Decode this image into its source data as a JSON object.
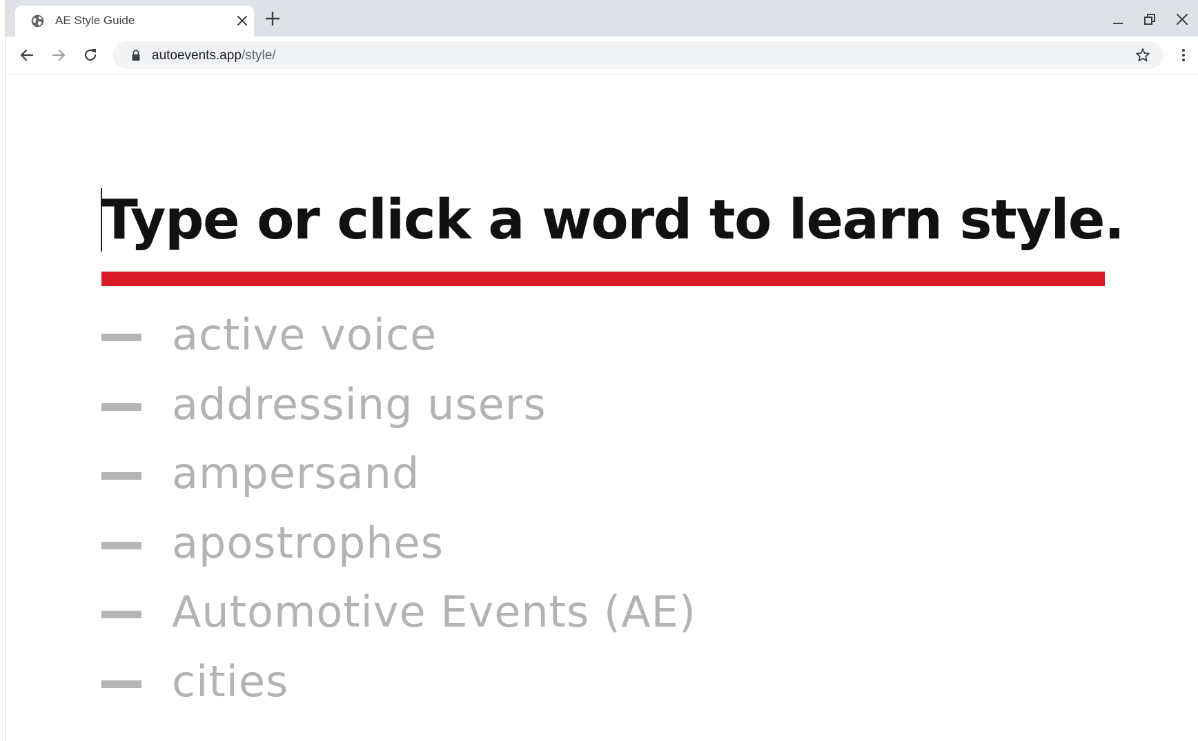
{
  "browser": {
    "tab": {
      "title": "AE Style Guide",
      "favicon": "globe-icon"
    },
    "address_bar": {
      "url_host": "autoevents.app",
      "url_path": "/style/"
    },
    "icons": {
      "back": "arrow-left-icon",
      "forward": "arrow-right-icon",
      "reload": "reload-icon",
      "bookmark": "star-icon",
      "menu": "kebab-menu-icon",
      "new_tab": "plus-icon",
      "close_tab": "close-icon",
      "minimize": "minimize-icon",
      "restore": "restore-icon",
      "close_window": "close-icon"
    }
  },
  "page": {
    "heading": "Type or click a word to learn style.",
    "accent_color": "#d81b26",
    "terms": [
      {
        "label": "active voice"
      },
      {
        "label": "addressing users"
      },
      {
        "label": "ampersand"
      },
      {
        "label": "apostrophes"
      },
      {
        "label": "Automotive Events (AE)"
      },
      {
        "label": "cities"
      }
    ]
  }
}
